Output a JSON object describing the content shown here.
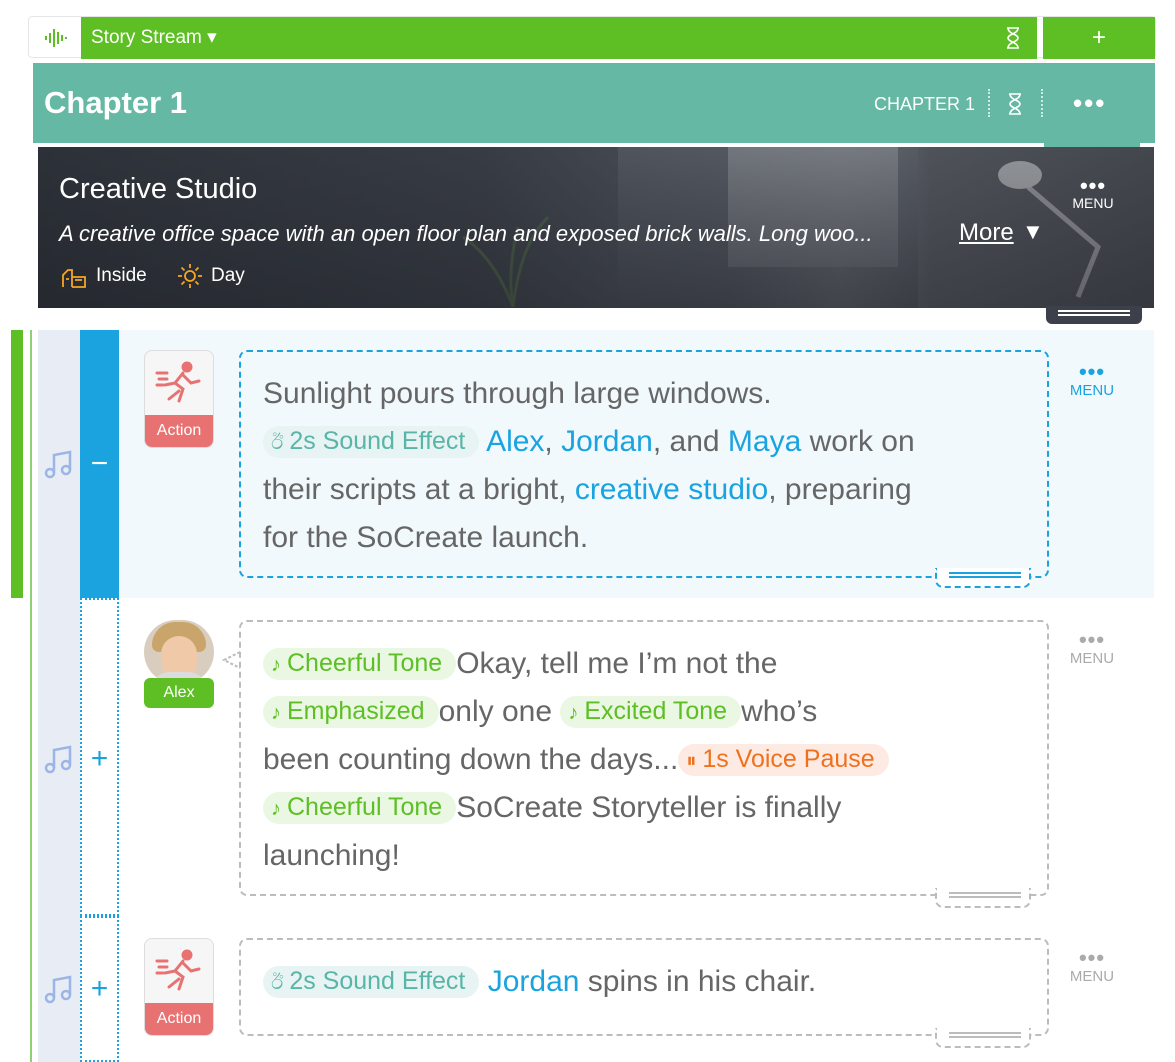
{
  "topbar": {
    "stream_label": "Story Stream ▾",
    "add_label": "+"
  },
  "chapter": {
    "title": "Chapter 1",
    "label": "CHAPTER 1",
    "menu_dots": "•••"
  },
  "scene": {
    "name": "Creative Studio",
    "description": "A creative office space with an open floor plan and exposed brick walls. Long woo...",
    "more_label": "More",
    "more_arrow": "▼",
    "location": "Inside",
    "time": "Day",
    "menu_dots": "•••",
    "menu_label": "MENU"
  },
  "blocks": [
    {
      "type": "Action",
      "type_label": "Action",
      "line1": "Sunlight pours through large windows.",
      "sound_effect": "2s Sound Effect",
      "char1": "Alex",
      "sep1": ",",
      "char2": "Jordan",
      "sep2": ", and",
      "char3": "Maya",
      "text2": " work on",
      "text3": "their scripts at a bright,",
      "location": "creative studio",
      "text4": ", preparing",
      "text5": "for the SoCreate launch.",
      "menu_dots": "•••",
      "menu_label": "MENU",
      "toggle": "−"
    },
    {
      "type": "Dialogue",
      "character": "Alex",
      "tone1": "Cheerful Tone",
      "text1": "Okay, tell me I’m not the",
      "emph": "Emphasized",
      "text2": "only one",
      "tone2": "Excited Tone",
      "text3": "who’s",
      "text4": "been counting down the days...",
      "pause": "1s Voice Pause",
      "tone3": "Cheerful Tone",
      "text5": "SoCreate Storyteller is finally",
      "text6": "launching!",
      "menu_dots": "•••",
      "menu_label": "MENU",
      "toggle": "+"
    },
    {
      "type": "Action",
      "type_label": "Action",
      "sound_effect": "2s Sound Effect",
      "char1": "Jordan",
      "text1": "spins in his chair.",
      "menu_dots": "•••",
      "menu_label": "MENU",
      "toggle": "+"
    }
  ],
  "colors": {
    "green": "#5dbf24",
    "teal": "#65b8a3",
    "blue": "#1aa3df",
    "action_red": "#e87272",
    "pause_orange": "#f0701e"
  }
}
